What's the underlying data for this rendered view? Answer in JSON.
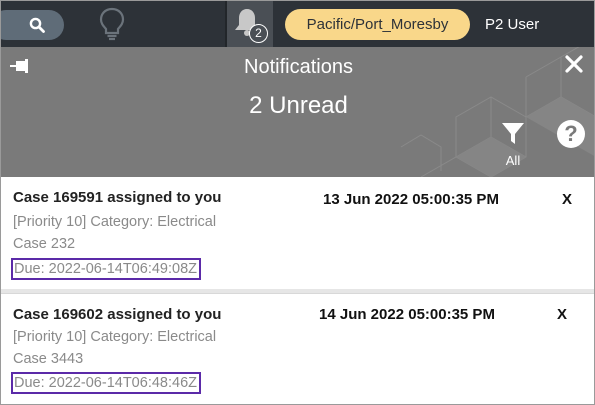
{
  "topbar": {
    "notification_count": "2",
    "timezone": "Pacific/Port_Moresby",
    "user": "P2 User",
    "icons": [
      "search-icon",
      "lightbulb-icon",
      "bell-icon"
    ]
  },
  "panel": {
    "title": "Notifications",
    "unread_label": "2 Unread",
    "filter_label": "All",
    "icons": [
      "pin-icon",
      "close-icon",
      "filter-icon",
      "help-icon"
    ],
    "help_glyph": "?"
  },
  "notifications": [
    {
      "title": "Case 169591 assigned to you",
      "datetime": "13 Jun 2022 05:00:35 PM",
      "category": "[Priority 10] Category: Electrical",
      "case": "Case 232",
      "due": "Due: 2022-06-14T06:49:08Z",
      "dismiss": "X"
    },
    {
      "title": "Case 169602 assigned to you",
      "datetime": "14 Jun 2022 05:00:35 PM",
      "category": "[Priority 10] Category: Electrical",
      "case": "Case 3443",
      "due": "Due: 2022-06-14T06:48:46Z",
      "dismiss": "X"
    }
  ],
  "colors": {
    "topbar": "#2d3238",
    "timezone_pill": "#f9d78a",
    "header_gray": "#7a7a7a",
    "due_highlight": "#5b2aa8"
  }
}
